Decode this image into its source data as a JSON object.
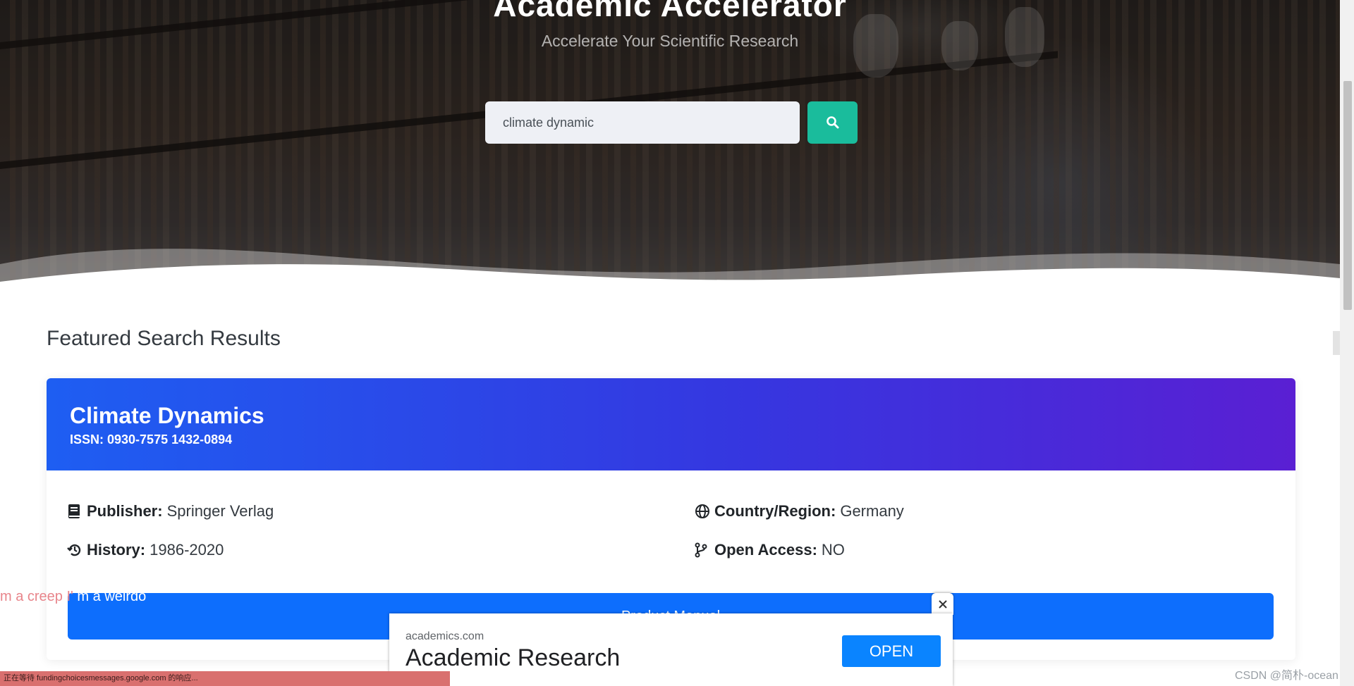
{
  "hero": {
    "title": "Academic Accelerator",
    "subtitle": "Accelerate Your Scientific Research"
  },
  "search": {
    "value": "climate dynamic",
    "button_icon": "search-icon"
  },
  "results": {
    "heading": "Featured Search Results",
    "journal": {
      "title": "Climate Dynamics",
      "issn": "ISSN: 0930-7575 1432-0894",
      "publisher_label": "Publisher:",
      "publisher_value": "Springer Verlag",
      "country_label": "Country/Region:",
      "country_value": "Germany",
      "history_label": "History:",
      "history_value": "1986-2020",
      "open_access_label": "Open Access:",
      "open_access_value": "NO",
      "detail_button_label": "Product Manual"
    }
  },
  "danmaku": {
    "pink_text": "m a creep I'",
    "white_text": "m a weirdo"
  },
  "ad": {
    "domain": "academics.com",
    "title": "Academic Research",
    "open_label": "OPEN"
  },
  "status_bar": {
    "text": "正在等待 fundingchoicesmessages.google.com 的响应..."
  },
  "watermark": {
    "text": "CSDN @简朴-ocean"
  },
  "colors": {
    "accent_teal": "#1abc9c",
    "card_gradient_start": "#1e5ef2",
    "card_gradient_end": "#5a1fd3",
    "button_blue": "#0d6efd",
    "ad_open_blue": "#0a84ff"
  }
}
